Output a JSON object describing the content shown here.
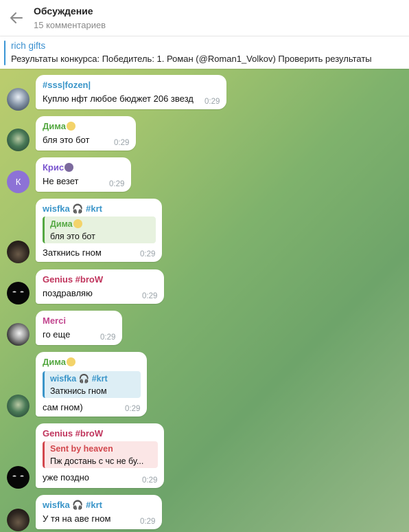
{
  "header": {
    "title": "Обсуждение",
    "subtitle": "15 комментариев"
  },
  "pinned": {
    "title": "rich gifts",
    "text": "Результаты конкурса:  Победитель: 1. Роман (@Roman1_Volkov)  Проверить результаты"
  },
  "colors": {
    "blue_sender": "#3a95c9",
    "green_sender": "#55a842",
    "purple_sender": "#7a55cf",
    "red_sender": "#c0345c",
    "pink_sender": "#c2468f"
  },
  "messages": [
    {
      "sender": "#sss|fozen|",
      "text": "Куплю нфт любое бюджет 206 звезд",
      "time": "0:29"
    },
    {
      "sender": "Дима",
      "text": "бля это бот",
      "time": "0:29"
    },
    {
      "sender": "Крис",
      "avatar_letter": "К",
      "text": "Не везет",
      "time": "0:29"
    },
    {
      "sender": "wisfka 🎧 #krt",
      "reply_sender": "Дима",
      "reply_text": "бля это бот",
      "text": "Заткнись гном",
      "time": "0:29"
    },
    {
      "sender": "Genius #broW",
      "text": "поздравляю",
      "time": "0:29"
    },
    {
      "sender": "Merci",
      "text": "го еще",
      "time": "0:29"
    },
    {
      "sender": "Дима",
      "reply_sender": "wisfka 🎧 #krt",
      "reply_text": "Заткнись гном",
      "text": "сам гном)",
      "time": "0:29"
    },
    {
      "sender": "Genius #broW",
      "reply_sender": "Sent by heaven",
      "reply_text": "Пж достань с чс не бу...",
      "text": "уже поздно",
      "time": "0:29"
    },
    {
      "sender": "wisfka 🎧 #krt",
      "text": "У тя на аве гном",
      "time": "0:29"
    }
  ]
}
